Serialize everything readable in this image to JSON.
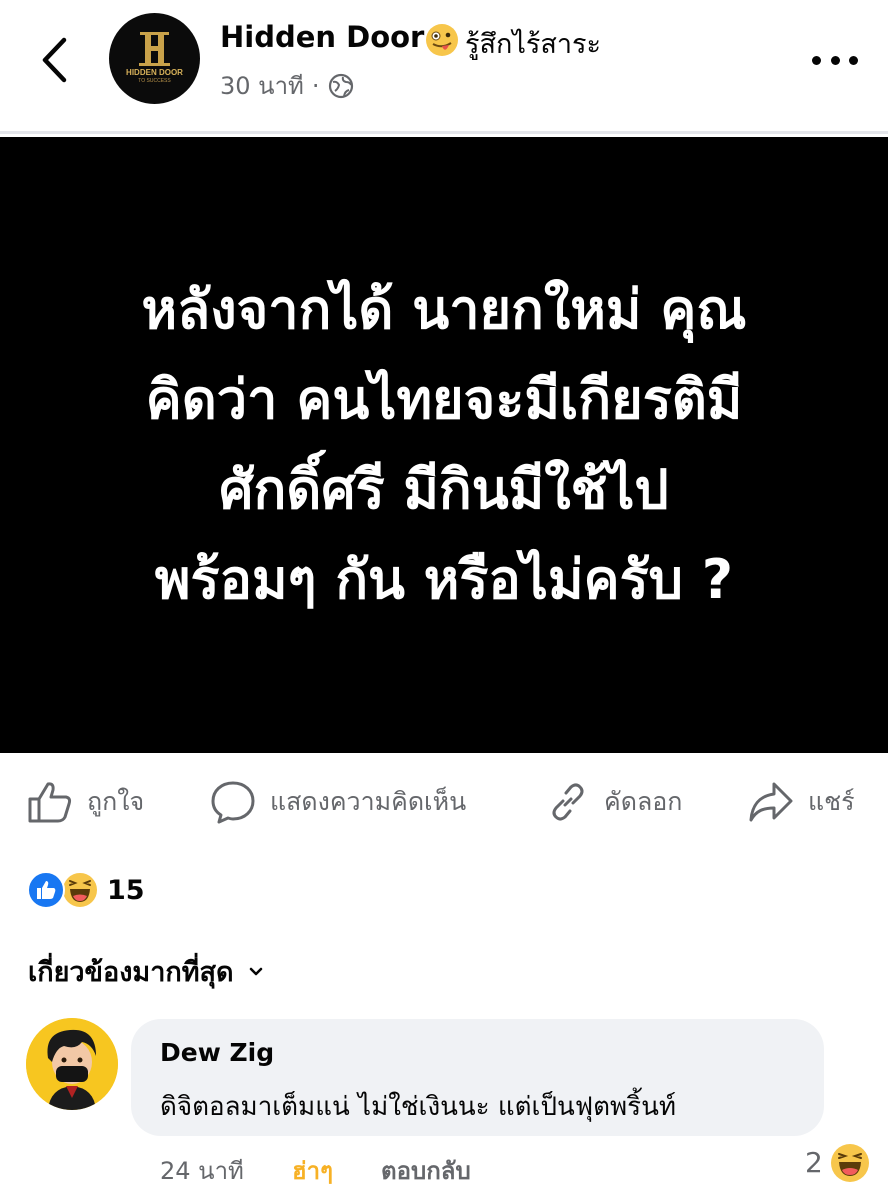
{
  "header": {
    "page_name": "Hidden Door",
    "feeling": "รู้สึกไร้สาระ",
    "time": "30 นาที",
    "separator": "·",
    "logo_text": "HIDDEN DOOR",
    "logo_subtext": "TO SUCCESS"
  },
  "post": {
    "image_text": "หลังจากได้ นายกใหม่ คุณ\nคิดว่า คนไทยจะมีเกียรติมี\nศักดิ์ศรี  มีกินมีใช้ไป\nพร้อมๆ กัน หรือไม่ครับ ?"
  },
  "actions": {
    "like": "ถูกใจ",
    "comment": "แสดงความคิดเห็น",
    "copy": "คัดลอก",
    "share": "แชร์"
  },
  "reactions": {
    "count": "15",
    "types": [
      "like",
      "haha"
    ]
  },
  "sort": {
    "label": "เกี่ยวข้องมากที่สุด"
  },
  "comment": {
    "author": "Dew Zig",
    "text": "ดิจิตอลมาเต็มแน่ ไม่ใช่เงินนะ แต่เป็นฟุตพริ้นท์",
    "time": "24 นาที",
    "my_reaction": "ฮ่าๆ",
    "reply": "ตอบกลับ",
    "reaction_count": "2",
    "reaction_type": "haha"
  },
  "colors": {
    "text_primary": "#050505",
    "text_secondary": "#65676b",
    "like_blue": "#1877f2",
    "haha_yellow": "#f7b125",
    "bubble_bg": "#f0f2f5",
    "post_bg": "#000000"
  }
}
